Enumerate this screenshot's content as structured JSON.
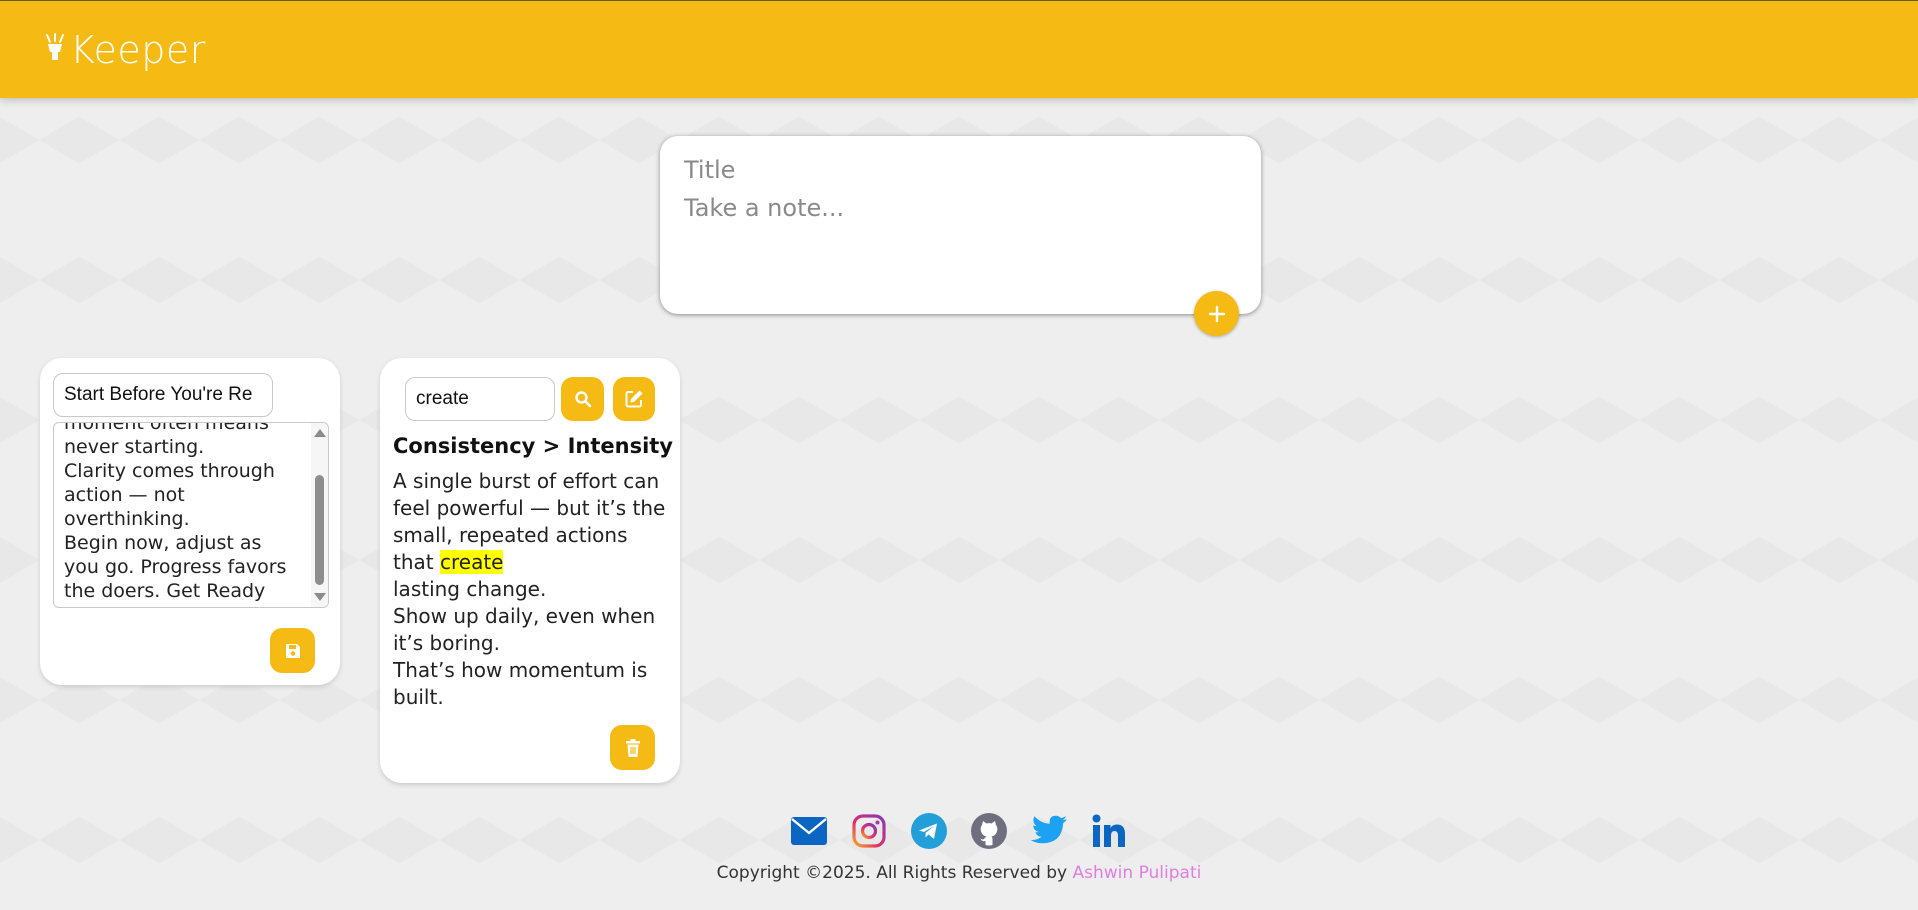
{
  "header": {
    "app_name": "Keeper"
  },
  "create_note": {
    "title_placeholder": "Title",
    "content_placeholder": "Take a note...",
    "add_icon": "plus-icon"
  },
  "notes": [
    {
      "mode": "editing",
      "title_value": "Start Before You're Re",
      "content_visible": "moment often means\nnever starting.\nClarity comes through\naction — not\noverthinking.\nBegin now, adjust as\nyou go. Progress favors\nthe doers. Get Ready",
      "save_icon": "floppy-disk-icon"
    },
    {
      "mode": "viewing",
      "search_value": "create",
      "title": "Consistency > Intensity",
      "body_before": "A single burst of effort can feel powerful — but it’s the small, repeated actions that ",
      "body_highlight": "create",
      "body_after": "\nlasting change.\nShow up daily, even when it’s boring.\nThat’s how momentum is built.",
      "search_icon": "search-icon",
      "edit_icon": "edit-icon",
      "delete_icon": "trash-icon"
    }
  ],
  "footer": {
    "social_icons": [
      "email-icon",
      "instagram-icon",
      "telegram-icon",
      "github-icon",
      "twitter-icon",
      "linkedin-icon"
    ],
    "copyright_text": "Copyright ©2025. All Rights Reserved by ",
    "author_name": "Ashwin Pulipati"
  },
  "colors": {
    "accent": "#f5ba13",
    "link": "#e07ee0",
    "highlight": "#ffff00"
  }
}
